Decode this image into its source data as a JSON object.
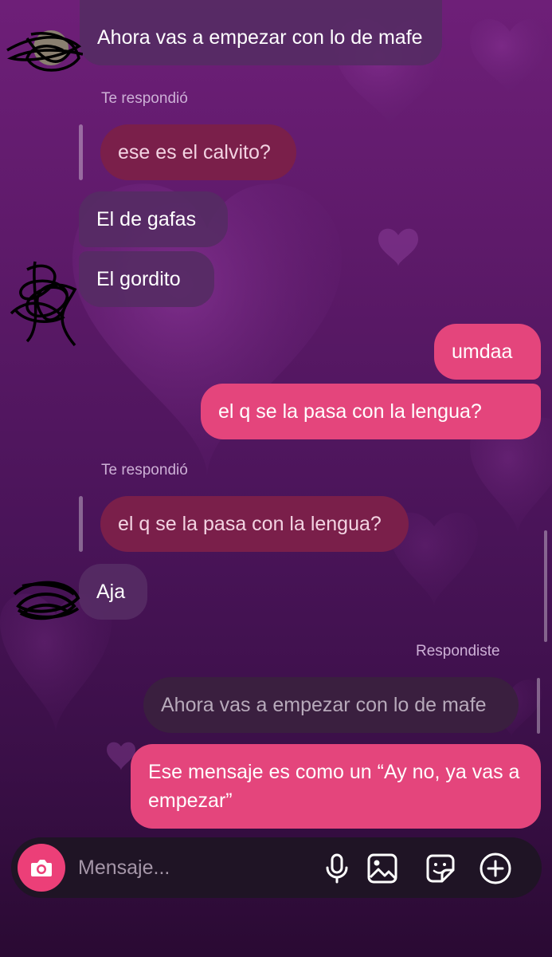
{
  "messages": [
    {
      "id": "m1",
      "text": "Ahora vas a empezar con lo de mafe"
    },
    {
      "id": "m2_label",
      "text": "Te respondió"
    },
    {
      "id": "m2_quote",
      "text": "ese es el calvito?"
    },
    {
      "id": "m3",
      "text": "El de gafas"
    },
    {
      "id": "m4",
      "text": "El gordito"
    },
    {
      "id": "m5",
      "text": "umdaa"
    },
    {
      "id": "m6",
      "text": "el q se la pasa con la lengua?"
    },
    {
      "id": "m7_label",
      "text": "Te respondió"
    },
    {
      "id": "m7_quote",
      "text": "el q se la pasa con la lengua?"
    },
    {
      "id": "m8",
      "text": "Aja"
    },
    {
      "id": "m9_label",
      "text": "Respondiste"
    },
    {
      "id": "m9_quote",
      "text": "Ahora vas a empezar con lo de mafe"
    },
    {
      "id": "m10",
      "text": "Ese mensaje es como un “Ay no, ya vas a empezar”"
    }
  ],
  "composer": {
    "placeholder": "Mensaje...",
    "icons": [
      "camera-icon",
      "microphone-icon",
      "gallery-icon",
      "sticker-icon",
      "add-icon"
    ]
  },
  "colors": {
    "sent_bubble": "#e4457c",
    "received_bubble": "#562b64",
    "quote_bubble": "#7a1f4a",
    "camera_button": "#ec3f78"
  }
}
